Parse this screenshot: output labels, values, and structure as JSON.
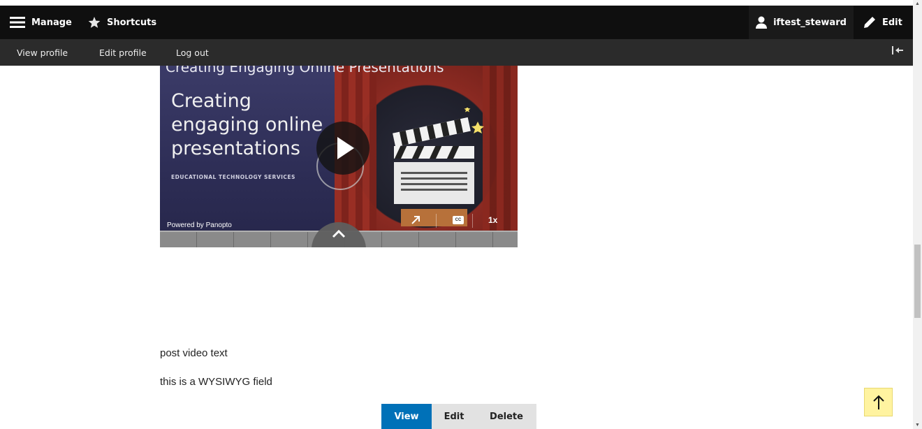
{
  "toolbar": {
    "manage_label": "Manage",
    "shortcuts_label": "Shortcuts",
    "user_label": "iftest_steward",
    "edit_label": "Edit"
  },
  "tray": {
    "items": [
      {
        "label": "View profile"
      },
      {
        "label": "Edit profile"
      },
      {
        "label": "Log out"
      }
    ]
  },
  "video": {
    "header_title": "Creating Engaging Online Presentations",
    "slide_title": "Creating engaging online presentations",
    "slide_subtitle": "EDUCATIONAL TECHNOLOGY SERVICES",
    "powered_by": "Powered by Panopto",
    "cc_label": "CC",
    "speed_label": "1x"
  },
  "content": {
    "paragraph_1": "post video text",
    "paragraph_2": "this is a WYSIWYG field"
  },
  "tabs": [
    {
      "label": "View",
      "active": true
    },
    {
      "label": "Edit",
      "active": false
    },
    {
      "label": "Delete",
      "active": false
    }
  ],
  "colors": {
    "toolbar_bg": "#0f0f0f",
    "tray_bg": "#2b2b2b",
    "active_tab": "#0071b8",
    "back_to_top": "#fff3a0"
  }
}
